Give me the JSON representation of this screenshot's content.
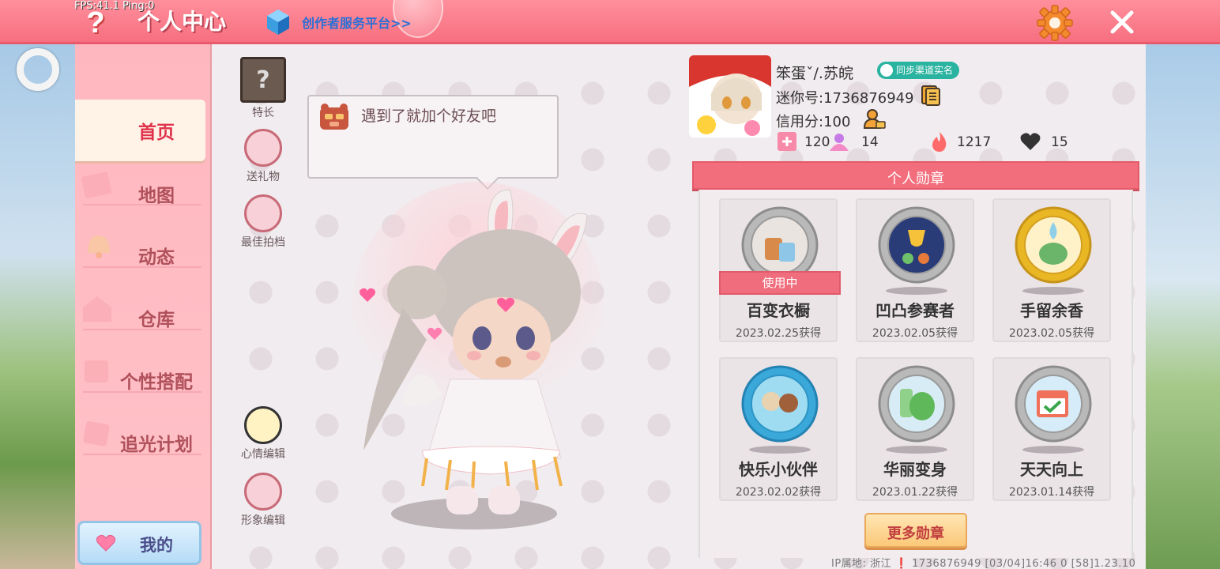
{
  "debug": {
    "fps_text": "FPS:41.1  Ping:0"
  },
  "header": {
    "title": "个人中心",
    "creator_link": "创作者服务平台>>",
    "icons": {
      "help": "help-icon",
      "settings": "gear-icon",
      "close": "close-icon",
      "creator": "cube-icon"
    },
    "accent_color": "#f76f80"
  },
  "sidebar": {
    "items": [
      {
        "label": "首页",
        "active": true
      },
      {
        "label": "地图",
        "active": false
      },
      {
        "label": "动态",
        "active": false
      },
      {
        "label": "仓库",
        "active": false
      },
      {
        "label": "个性搭配",
        "active": false
      },
      {
        "label": "追光计划",
        "active": false
      }
    ],
    "my_button": "我的"
  },
  "actions": {
    "specialty": "特长",
    "send_gift": "送礼物",
    "best_partner": "最佳拍档",
    "mood_edit": "心情编辑",
    "avatar_edit": "形象编辑"
  },
  "speech_bubble": {
    "text": "遇到了就加个好友吧"
  },
  "profile": {
    "nickname": "笨蛋ˇ/.苏皖",
    "realname_badge": "同步渠道实名",
    "mini_id": "迷你号:1736876949",
    "credit": "信用分:100",
    "stats": [
      {
        "icon": "card-icon",
        "value": "120"
      },
      {
        "icon": "fans-icon",
        "value": "14"
      },
      {
        "icon": "flame-icon",
        "value": "1217"
      },
      {
        "icon": "heart-icon",
        "value": "15"
      }
    ]
  },
  "badges": {
    "header": "个人勋章",
    "in_use_label": "使用中",
    "items": [
      {
        "name": "百变衣橱",
        "date": "2023.02.25获得",
        "in_use": true
      },
      {
        "name": "凹凸参赛者",
        "date": "2023.02.05获得",
        "in_use": false
      },
      {
        "name": "手留余香",
        "date": "2023.02.05获得",
        "in_use": false
      },
      {
        "name": "快乐小伙伴",
        "date": "2023.02.02获得",
        "in_use": false
      },
      {
        "name": "华丽变身",
        "date": "2023.01.22获得",
        "in_use": false
      },
      {
        "name": "天天向上",
        "date": "2023.01.14获得",
        "in_use": false
      }
    ],
    "more_button": "更多勋章"
  },
  "footer": {
    "text": "IP属地: 浙江 ❗    1736876949    [03/04]16:46 0   [58]1.23.10"
  }
}
